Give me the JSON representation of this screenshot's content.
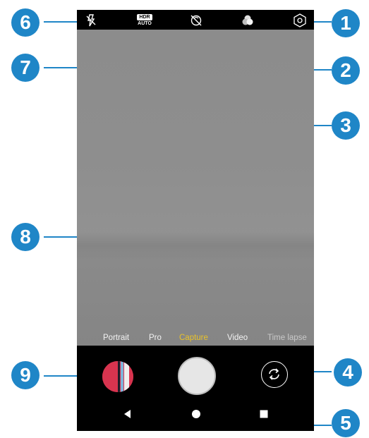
{
  "camera_modes": [
    {
      "label": "Portrait",
      "active": false
    },
    {
      "label": "Pro",
      "active": false
    },
    {
      "label": "Capture",
      "active": true
    },
    {
      "label": "Video",
      "active": false
    },
    {
      "label": "Time lapse",
      "active": false
    }
  ],
  "top_bar": {
    "hdr_label_top": "HDR",
    "hdr_label_bottom": "AUTO"
  },
  "callouts": [
    "1",
    "2",
    "3",
    "4",
    "5",
    "6",
    "7",
    "8",
    "9"
  ],
  "icons": {
    "flash": "flash-off-icon",
    "hdr": "hdr-auto-icon",
    "filter": "filter-off-icon",
    "beauty": "color-filters-icon",
    "settings": "settings-hexagon-icon",
    "switch_camera": "switch-camera-icon",
    "shutter": "shutter-button",
    "gallery": "gallery-thumbnail",
    "nav_back": "back-triangle-icon",
    "nav_home": "home-circle-icon",
    "nav_recents": "recents-square-icon"
  },
  "colors": {
    "callout": "#1f86c7",
    "active_mode": "#e8c22a"
  }
}
